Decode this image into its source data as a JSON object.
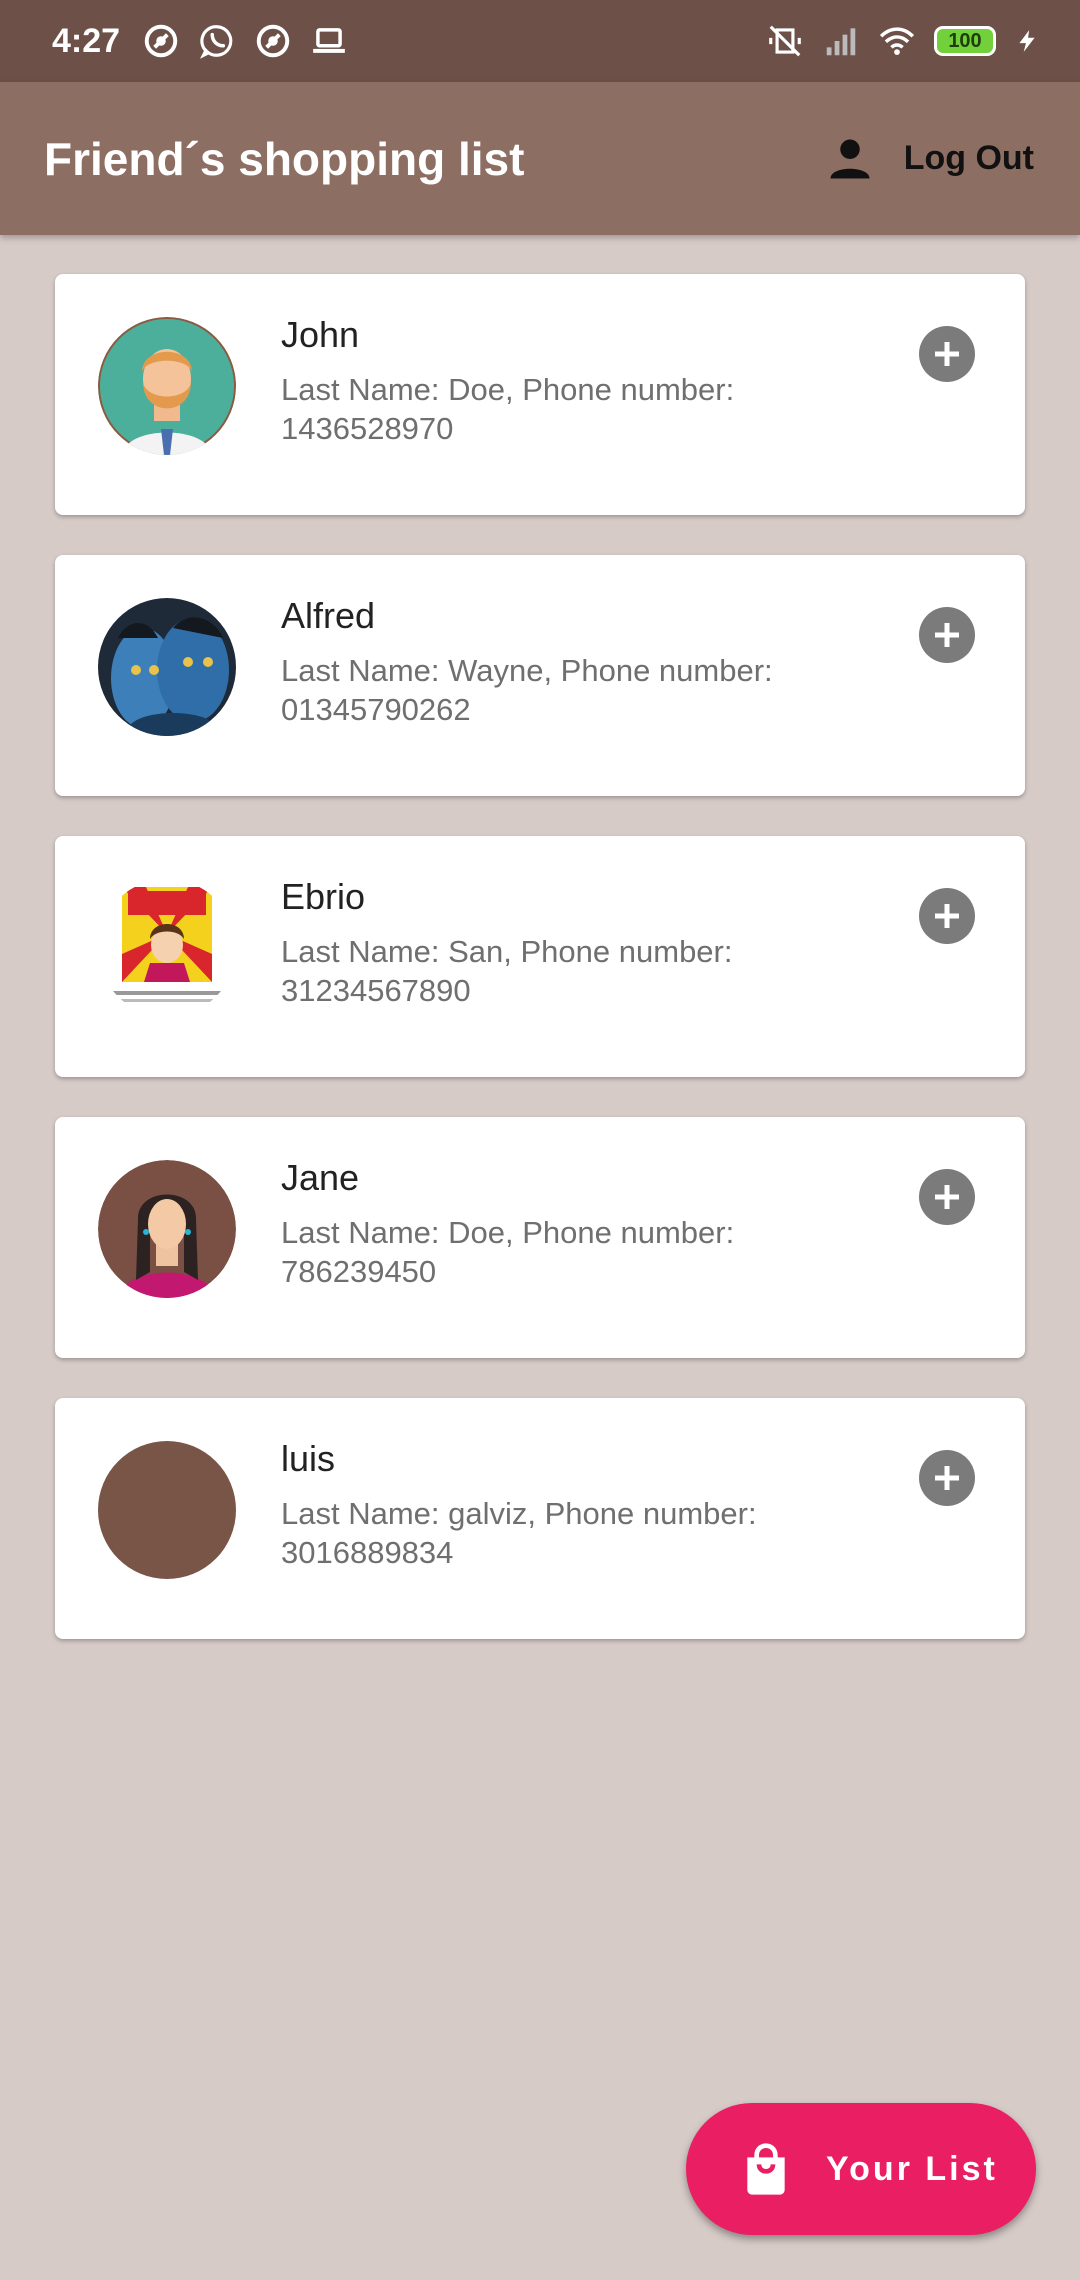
{
  "status_bar": {
    "time": "4:27",
    "battery": "100",
    "left_icons": [
      "notification-icon",
      "whatsapp-icon",
      "notification-icon",
      "laptop-icon"
    ],
    "right_icons": [
      "vibrate-off-icon",
      "signal-icon",
      "wifi-icon",
      "battery-icon",
      "charging-icon"
    ]
  },
  "app_bar": {
    "title": "Friend´s shopping list",
    "logout_label": "Log Out"
  },
  "friends": [
    {
      "name": "John",
      "details": "Last Name: Doe,  Phone number: 1436528970",
      "avatar": "avatar-man-beard"
    },
    {
      "name": "Alfred",
      "details": "Last Name: Wayne,  Phone number: 01345790262",
      "avatar": "avatar-avatar-movie"
    },
    {
      "name": "Ebrio",
      "details": "Last Name: San,  Phone number: 31234567890",
      "avatar": "avatar-meme"
    },
    {
      "name": "Jane",
      "details": "Last Name: Doe,  Phone number: 786239450",
      "avatar": "avatar-woman"
    },
    {
      "name": "luis",
      "details": "Last Name: galviz,  Phone number: 3016889834",
      "avatar": "avatar-plain"
    }
  ],
  "fab": {
    "label": "Your List",
    "icon": "shopping-bag-icon"
  },
  "colors": {
    "status_bar": "#6d5048",
    "app_bar": "#8d6e63",
    "background": "#d7cbc8",
    "fab": "#e91e63",
    "add_button": "#7b7b7b"
  }
}
